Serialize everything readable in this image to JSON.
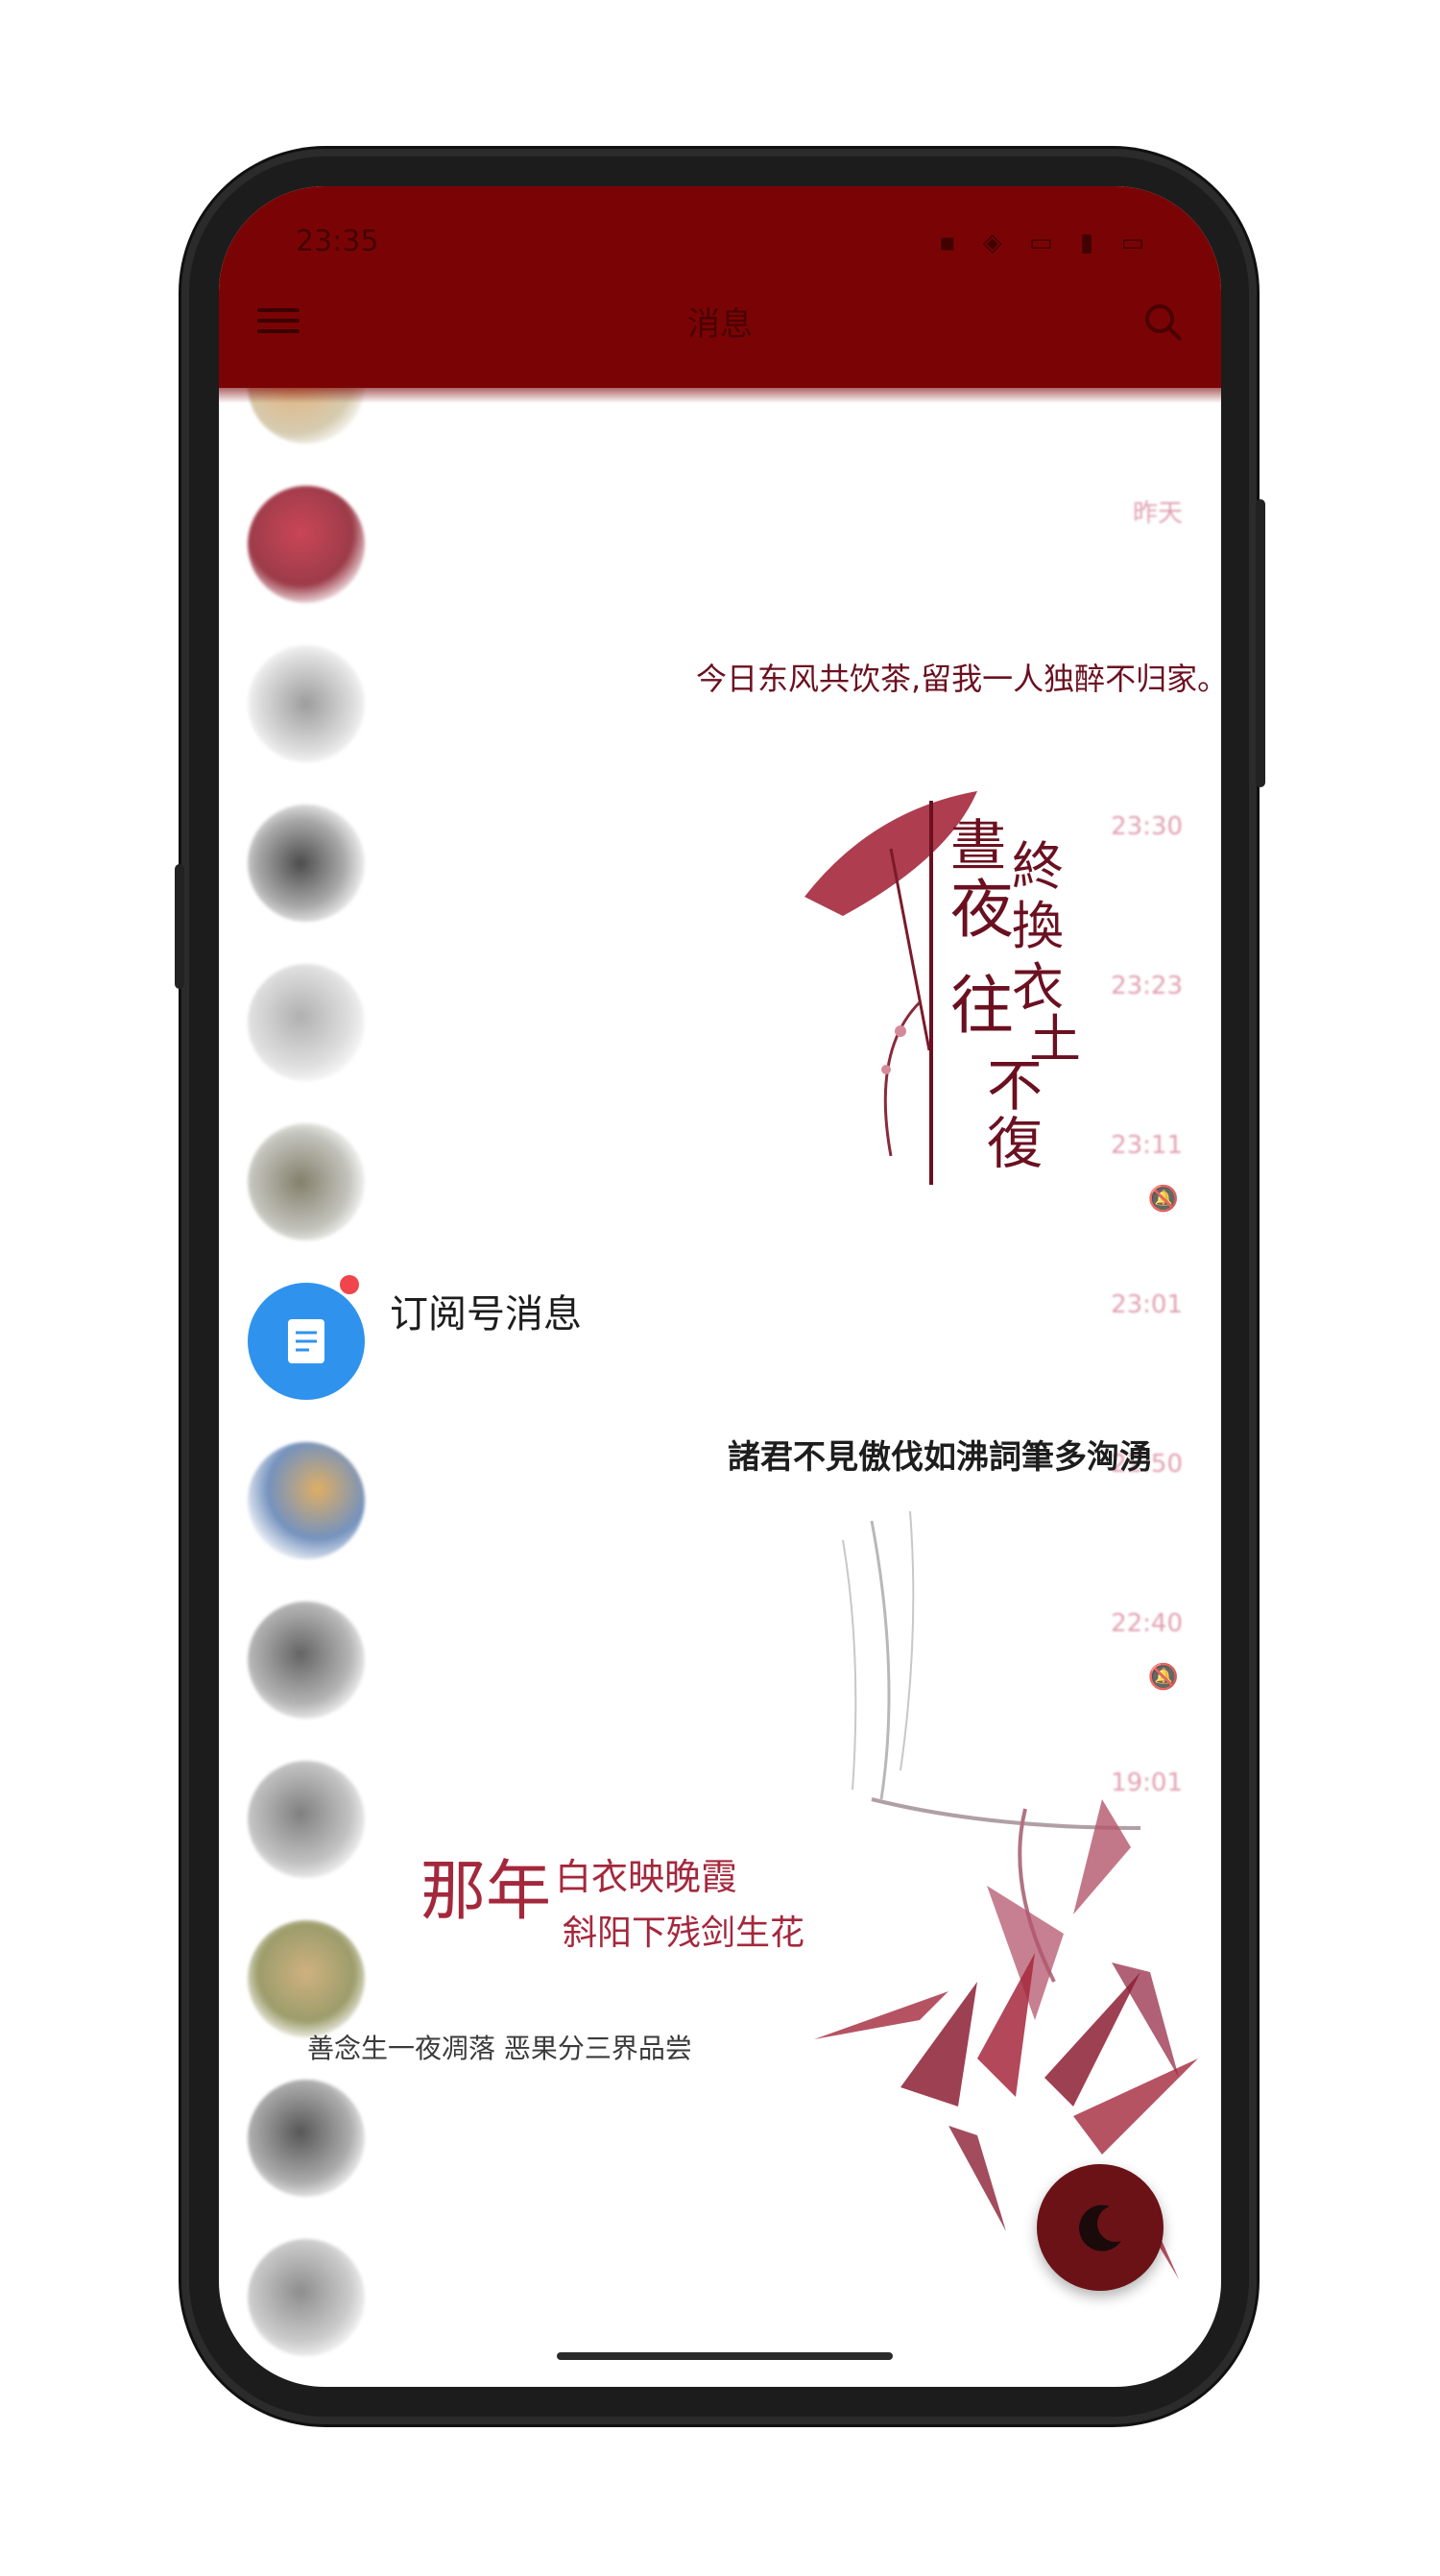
{
  "status_bar": {
    "time": "23:35",
    "icons": "▪ ◈ ▭ ▮ ▭"
  },
  "app_bar": {
    "title": "消息",
    "menu_icon": "menu-icon",
    "search_icon": "search-icon"
  },
  "poems": {
    "line1": "今日东风共饮茶,留我一人独醉不归家。",
    "line2": "諸君不見傲伐如沸詞筆多洶湧",
    "line3": "善念生一夜凋落 恶果分三界品尝",
    "calligraphy_a": [
      "晝",
      "夜",
      "終",
      "換",
      "往",
      "衣",
      "不",
      "土",
      "復"
    ],
    "calligraphy_b_big": "那年",
    "calligraphy_b_1": "白衣映晚霞",
    "calligraphy_b_2": "斜阳下残剑生花"
  },
  "conversations": [
    {
      "name": "",
      "snippet": "",
      "time": "",
      "muted": false,
      "avatar": "#c9b58d"
    },
    {
      "name": "",
      "snippet": "",
      "time": "昨天",
      "muted": false,
      "avatar": "#b32a3c"
    },
    {
      "name": "",
      "snippet": "",
      "time": "",
      "muted": false,
      "avatar": "#a7a7a7"
    },
    {
      "name": "",
      "snippet": "",
      "time": "23:30",
      "muted": false,
      "avatar": "#5a5a5a"
    },
    {
      "name": "",
      "snippet": "",
      "time": "23:23",
      "muted": false,
      "avatar": "#b8b8b8"
    },
    {
      "name": "",
      "snippet": "",
      "time": "23:11",
      "muted": true,
      "avatar": "#7d7d78"
    },
    {
      "name": "订阅号消息",
      "snippet": "",
      "time": "23:01",
      "muted": false,
      "avatar": "#2f93ee",
      "unread": true
    },
    {
      "name": "",
      "snippet": "",
      "time": "22:50",
      "muted": false,
      "avatar": "#5d80b3"
    },
    {
      "name": "",
      "snippet": "",
      "time": "22:40",
      "muted": true,
      "avatar": "#606060"
    },
    {
      "name": "",
      "snippet": "",
      "time": "19:01",
      "muted": false,
      "avatar": "#8a8a8a"
    },
    {
      "name": "",
      "snippet": "",
      "time": "",
      "muted": false,
      "avatar": "#a8a45a"
    },
    {
      "name": "",
      "snippet": "",
      "time": "",
      "muted": false,
      "avatar": "#707070"
    },
    {
      "name": "",
      "snippet": "",
      "time": "",
      "muted": false,
      "avatar": "#909090"
    }
  ],
  "fab": {
    "icon": "moon-icon"
  },
  "colors": {
    "primary": "#7a0405",
    "accent": "#c2506a",
    "unread_dot": "#f0454d"
  }
}
